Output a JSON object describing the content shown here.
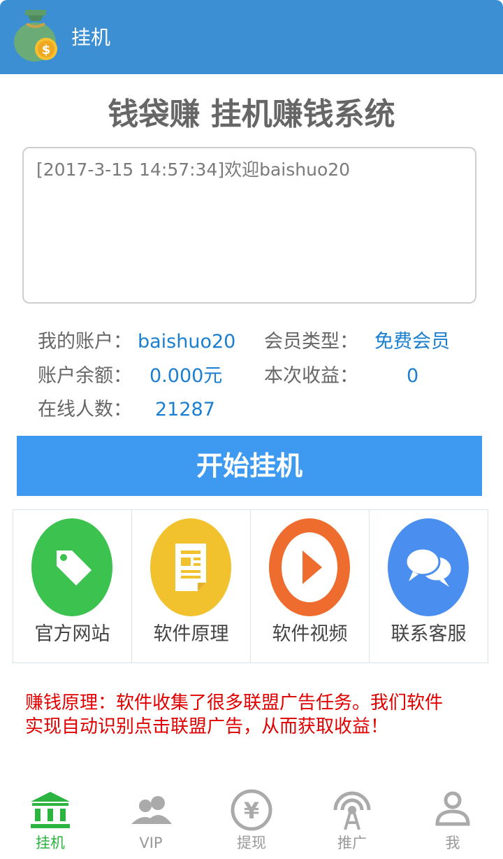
{
  "header": {
    "title": "挂机"
  },
  "main_title": "钱袋赚 挂机赚钱系统",
  "log": {
    "lines": [
      "[2017-3-15 14:57:34]欢迎baishuo20"
    ]
  },
  "info": {
    "account_label": "我的账户：",
    "account_value": "baishuo20",
    "member_type_label": "会员类型：",
    "member_type_value": "免费会员",
    "balance_label": "账户余额：",
    "balance_value": "0.000元",
    "earnings_label": "本次收益：",
    "earnings_value": "0",
    "online_label": "在线人数：",
    "online_value": "21287"
  },
  "start_button": "开始挂机",
  "features": [
    {
      "label": "官方网站",
      "icon": "tag-icon",
      "color": "#3cc24f"
    },
    {
      "label": "软件原理",
      "icon": "document-icon",
      "color": "#f2c12e"
    },
    {
      "label": "软件视频",
      "icon": "play-icon",
      "color": "#ee6c2d"
    },
    {
      "label": "联系客服",
      "icon": "chat-icon",
      "color": "#4a8ef0"
    }
  ],
  "notice": {
    "line1": "赚钱原理：软件收集了很多联盟广告任务。我们软件",
    "line2": "实现自动识别点击联盟广告，从而获取收益！"
  },
  "tabs": [
    {
      "label": "挂机",
      "icon": "bank-icon",
      "active": true
    },
    {
      "label": "VIP",
      "icon": "users-icon",
      "active": false
    },
    {
      "label": "提现",
      "icon": "yen-icon",
      "active": false
    },
    {
      "label": "推广",
      "icon": "broadcast-icon",
      "active": false
    },
    {
      "label": "我",
      "icon": "person-icon",
      "active": false
    }
  ],
  "colors": {
    "header": "#3d8fd3",
    "accent_blue": "#1a7fd0",
    "button": "#3d9af0",
    "notice_red": "#e00000",
    "tab_active": "#2db33f",
    "tab_inactive": "#999999"
  }
}
